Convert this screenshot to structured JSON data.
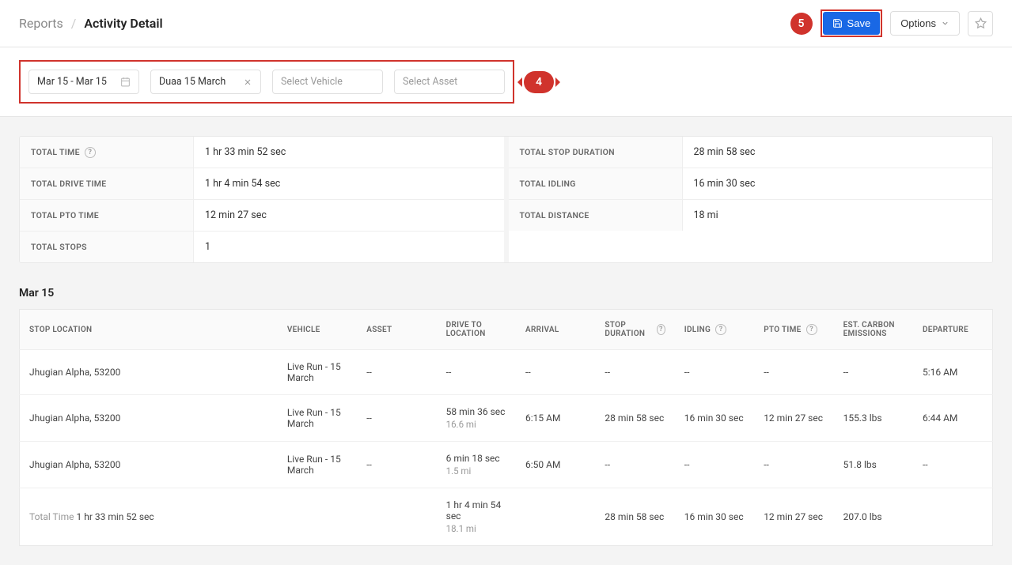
{
  "breadcrumb": {
    "parent": "Reports",
    "current": "Activity Detail"
  },
  "header": {
    "save_label": "Save",
    "options_label": "Options",
    "callout5": "5"
  },
  "filters": {
    "date_range": "Mar 15 - Mar 15",
    "driver": "Duaa 15 March",
    "vehicle_placeholder": "Select Vehicle",
    "asset_placeholder": "Select Asset",
    "callout4": "4"
  },
  "summary": {
    "left": [
      {
        "label": "TOTAL TIME",
        "help": true,
        "value": "1 hr 33 min 52 sec"
      },
      {
        "label": "TOTAL DRIVE TIME",
        "help": false,
        "value": "1 hr 4 min 54 sec"
      },
      {
        "label": "TOTAL PTO TIME",
        "help": false,
        "value": "12 min 27 sec"
      },
      {
        "label": "TOTAL STOPS",
        "help": false,
        "value": "1"
      }
    ],
    "right": [
      {
        "label": "TOTAL STOP DURATION",
        "help": false,
        "value": "28 min 58 sec"
      },
      {
        "label": "TOTAL IDLING",
        "help": false,
        "value": "16 min 30 sec"
      },
      {
        "label": "TOTAL DISTANCE",
        "help": false,
        "value": "18 mi"
      }
    ]
  },
  "section": {
    "title": "Mar 15"
  },
  "table": {
    "columns": [
      {
        "label": "STOP LOCATION",
        "help": false
      },
      {
        "label": "VEHICLE",
        "help": false
      },
      {
        "label": "ASSET",
        "help": false
      },
      {
        "label": "DRIVE TO LOCATION",
        "help": false
      },
      {
        "label": "ARRIVAL",
        "help": false
      },
      {
        "label": "STOP DURATION",
        "help": true
      },
      {
        "label": "IDLING",
        "help": true
      },
      {
        "label": "PTO TIME",
        "help": true
      },
      {
        "label": "EST. CARBON EMISSIONS",
        "help": false
      },
      {
        "label": "DEPARTURE",
        "help": false
      }
    ],
    "rows": [
      {
        "stop_location": "Jhugian Alpha, 53200",
        "vehicle": "Live Run - 15 March",
        "asset": "--",
        "drive_to": {
          "main": "--",
          "sub": ""
        },
        "arrival": "--",
        "stop_duration": "--",
        "idling": "--",
        "pto_time": "--",
        "emissions": "--",
        "departure": "5:16 AM"
      },
      {
        "stop_location": "Jhugian Alpha, 53200",
        "vehicle": "Live Run - 15 March",
        "asset": "--",
        "drive_to": {
          "main": "58 min 36 sec",
          "sub": "16.6 mi"
        },
        "arrival": "6:15 AM",
        "stop_duration": "28 min 58 sec",
        "idling": "16 min 30 sec",
        "pto_time": "12 min 27 sec",
        "emissions": "155.3 lbs",
        "departure": "6:44 AM"
      },
      {
        "stop_location": "Jhugian Alpha, 53200",
        "vehicle": "Live Run - 15 March",
        "asset": "--",
        "drive_to": {
          "main": "6 min 18 sec",
          "sub": "1.5 mi"
        },
        "arrival": "6:50 AM",
        "stop_duration": "--",
        "idling": "--",
        "pto_time": "--",
        "emissions": "51.8 lbs",
        "departure": "--"
      }
    ],
    "footer": {
      "prefix": "Total Time",
      "total_time": "1 hr 33 min 52 sec",
      "drive_to": {
        "main": "1 hr 4 min 54 sec",
        "sub": "18.1 mi"
      },
      "stop_duration": "28 min 58 sec",
      "idling": "16 min 30 sec",
      "pto_time": "12 min 27 sec",
      "emissions": "207.0 lbs"
    }
  }
}
